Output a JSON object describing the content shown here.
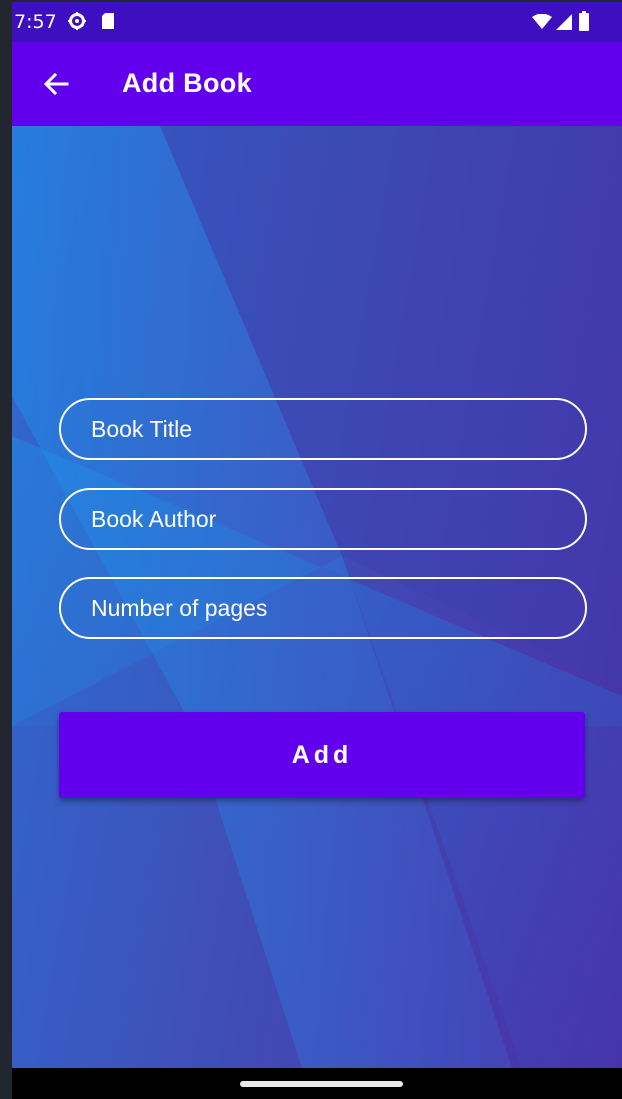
{
  "status_bar": {
    "time": "7:57",
    "left_icons": [
      "settings-gear-icon",
      "sim-card-icon"
    ],
    "right_icons": [
      "wifi-icon",
      "cellular-signal-icon",
      "battery-icon"
    ]
  },
  "app_bar": {
    "back_icon": "arrow-back-icon",
    "title": "Add Book"
  },
  "form": {
    "book_title": {
      "value": "",
      "placeholder": "Book Title"
    },
    "book_author": {
      "value": "",
      "placeholder": "Book Author"
    },
    "pages": {
      "value": "",
      "placeholder": "Number of pages"
    },
    "submit_label": "Add"
  },
  "colors": {
    "primary": "#6200ee",
    "status_bar": "#3d0fc0",
    "background_gradient_start": "#2f6ad0",
    "background_gradient_end": "#4a2fa8",
    "field_border": "#ffffff"
  }
}
